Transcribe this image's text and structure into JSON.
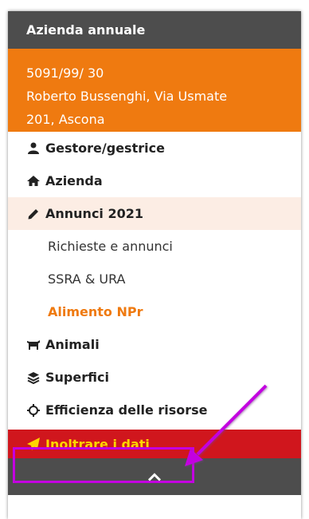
{
  "header": {
    "title": "Azienda annuale"
  },
  "farm": {
    "line1": "5091/99/ 30",
    "line2": "Roberto Bussenghi, Via Usmate",
    "line3": "201, Ascona"
  },
  "menu": {
    "operator": "Gestore/gestrice",
    "farm": "Azienda",
    "announcements": "Annunci 2021",
    "sub": {
      "requests": "Richieste e annunci",
      "ssra": "SSRA & URA",
      "feed": "Alimento NPr"
    },
    "animals": "Animali",
    "surfaces": "Superfici",
    "efficiency": "Efficienza delle risorse"
  },
  "submit": {
    "label": "Inoltrare i dati"
  },
  "colors": {
    "header": "#4d4d4d",
    "farm_bg": "#ef7a10",
    "submit_bg": "#d0161d",
    "submit_text": "#ffd400",
    "annotation": "#c300e0"
  }
}
